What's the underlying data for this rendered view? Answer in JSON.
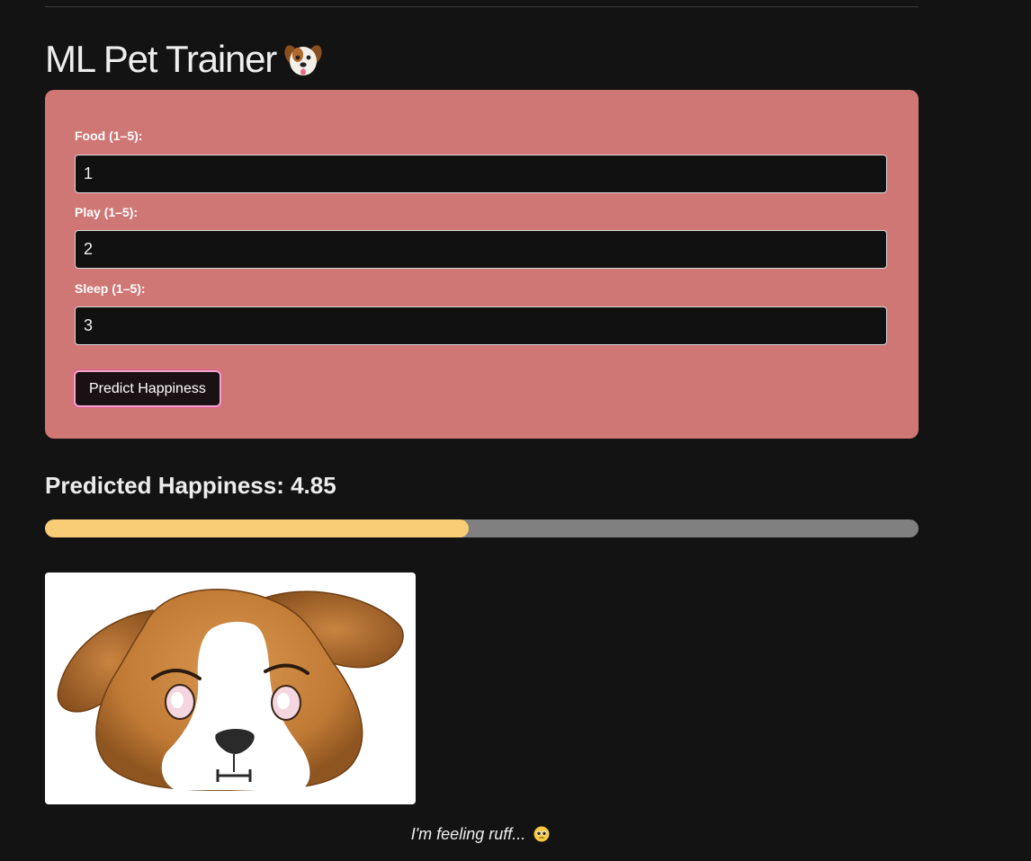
{
  "app": {
    "title": "ML Pet Trainer",
    "title_icon": "dog-face-icon"
  },
  "form": {
    "fields": [
      {
        "label": "Food (1–5):",
        "value": "1"
      },
      {
        "label": "Play (1–5):",
        "value": "2"
      },
      {
        "label": "Sleep (1–5):",
        "value": "3"
      }
    ],
    "submit_label": "Predict Happiness"
  },
  "result": {
    "heading": "Predicted Happiness: 4.85",
    "progress_fraction": 0.485,
    "caption": "I'm feeling ruff...",
    "caption_icon": "pleading-face-icon",
    "image_icon": "dog-face-icon"
  },
  "colors": {
    "card_bg": "#cf7775",
    "progress_fill": "#f9cd75",
    "progress_track": "#808080",
    "button_border": "#f1a7c9"
  }
}
